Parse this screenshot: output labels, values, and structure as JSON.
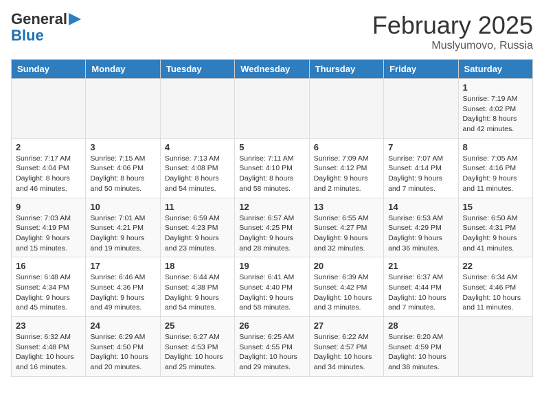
{
  "header": {
    "logo_general": "General",
    "logo_blue": "Blue",
    "month_title": "February 2025",
    "location": "Muslyumovo, Russia"
  },
  "days_of_week": [
    "Sunday",
    "Monday",
    "Tuesday",
    "Wednesday",
    "Thursday",
    "Friday",
    "Saturday"
  ],
  "weeks": [
    [
      {
        "day": "",
        "info": ""
      },
      {
        "day": "",
        "info": ""
      },
      {
        "day": "",
        "info": ""
      },
      {
        "day": "",
        "info": ""
      },
      {
        "day": "",
        "info": ""
      },
      {
        "day": "",
        "info": ""
      },
      {
        "day": "1",
        "info": "Sunrise: 7:19 AM\nSunset: 4:02 PM\nDaylight: 8 hours and 42 minutes."
      }
    ],
    [
      {
        "day": "2",
        "info": "Sunrise: 7:17 AM\nSunset: 4:04 PM\nDaylight: 8 hours and 46 minutes."
      },
      {
        "day": "3",
        "info": "Sunrise: 7:15 AM\nSunset: 4:06 PM\nDaylight: 8 hours and 50 minutes."
      },
      {
        "day": "4",
        "info": "Sunrise: 7:13 AM\nSunset: 4:08 PM\nDaylight: 8 hours and 54 minutes."
      },
      {
        "day": "5",
        "info": "Sunrise: 7:11 AM\nSunset: 4:10 PM\nDaylight: 8 hours and 58 minutes."
      },
      {
        "day": "6",
        "info": "Sunrise: 7:09 AM\nSunset: 4:12 PM\nDaylight: 9 hours and 2 minutes."
      },
      {
        "day": "7",
        "info": "Sunrise: 7:07 AM\nSunset: 4:14 PM\nDaylight: 9 hours and 7 minutes."
      },
      {
        "day": "8",
        "info": "Sunrise: 7:05 AM\nSunset: 4:16 PM\nDaylight: 9 hours and 11 minutes."
      }
    ],
    [
      {
        "day": "9",
        "info": "Sunrise: 7:03 AM\nSunset: 4:19 PM\nDaylight: 9 hours and 15 minutes."
      },
      {
        "day": "10",
        "info": "Sunrise: 7:01 AM\nSunset: 4:21 PM\nDaylight: 9 hours and 19 minutes."
      },
      {
        "day": "11",
        "info": "Sunrise: 6:59 AM\nSunset: 4:23 PM\nDaylight: 9 hours and 23 minutes."
      },
      {
        "day": "12",
        "info": "Sunrise: 6:57 AM\nSunset: 4:25 PM\nDaylight: 9 hours and 28 minutes."
      },
      {
        "day": "13",
        "info": "Sunrise: 6:55 AM\nSunset: 4:27 PM\nDaylight: 9 hours and 32 minutes."
      },
      {
        "day": "14",
        "info": "Sunrise: 6:53 AM\nSunset: 4:29 PM\nDaylight: 9 hours and 36 minutes."
      },
      {
        "day": "15",
        "info": "Sunrise: 6:50 AM\nSunset: 4:31 PM\nDaylight: 9 hours and 41 minutes."
      }
    ],
    [
      {
        "day": "16",
        "info": "Sunrise: 6:48 AM\nSunset: 4:34 PM\nDaylight: 9 hours and 45 minutes."
      },
      {
        "day": "17",
        "info": "Sunrise: 6:46 AM\nSunset: 4:36 PM\nDaylight: 9 hours and 49 minutes."
      },
      {
        "day": "18",
        "info": "Sunrise: 6:44 AM\nSunset: 4:38 PM\nDaylight: 9 hours and 54 minutes."
      },
      {
        "day": "19",
        "info": "Sunrise: 6:41 AM\nSunset: 4:40 PM\nDaylight: 9 hours and 58 minutes."
      },
      {
        "day": "20",
        "info": "Sunrise: 6:39 AM\nSunset: 4:42 PM\nDaylight: 10 hours and 3 minutes."
      },
      {
        "day": "21",
        "info": "Sunrise: 6:37 AM\nSunset: 4:44 PM\nDaylight: 10 hours and 7 minutes."
      },
      {
        "day": "22",
        "info": "Sunrise: 6:34 AM\nSunset: 4:46 PM\nDaylight: 10 hours and 11 minutes."
      }
    ],
    [
      {
        "day": "23",
        "info": "Sunrise: 6:32 AM\nSunset: 4:48 PM\nDaylight: 10 hours and 16 minutes."
      },
      {
        "day": "24",
        "info": "Sunrise: 6:29 AM\nSunset: 4:50 PM\nDaylight: 10 hours and 20 minutes."
      },
      {
        "day": "25",
        "info": "Sunrise: 6:27 AM\nSunset: 4:53 PM\nDaylight: 10 hours and 25 minutes."
      },
      {
        "day": "26",
        "info": "Sunrise: 6:25 AM\nSunset: 4:55 PM\nDaylight: 10 hours and 29 minutes."
      },
      {
        "day": "27",
        "info": "Sunrise: 6:22 AM\nSunset: 4:57 PM\nDaylight: 10 hours and 34 minutes."
      },
      {
        "day": "28",
        "info": "Sunrise: 6:20 AM\nSunset: 4:59 PM\nDaylight: 10 hours and 38 minutes."
      },
      {
        "day": "",
        "info": ""
      }
    ]
  ]
}
